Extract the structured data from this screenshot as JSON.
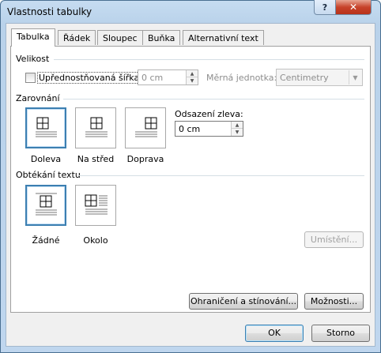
{
  "window": {
    "title": "Vlastnosti tabulky",
    "help_glyph": "?",
    "close_glyph": "✕"
  },
  "tabs": [
    "Tabulka",
    "Řádek",
    "Sloupec",
    "Buňka",
    "Alternativní text"
  ],
  "size": {
    "group_label": "Velikost",
    "preferred_width_label": "Upřednostňovaná šířka:",
    "preferred_width_checked": false,
    "width_value": "0 cm",
    "unit_label": "Měrná jednotka:",
    "unit_value": "Centimetry"
  },
  "alignment": {
    "group_label": "Zarovnání",
    "options": [
      "Doleva",
      "Na střed",
      "Doprava"
    ],
    "selected": "Doleva",
    "indent_label": "Odsazení zleva:",
    "indent_value": "0 cm"
  },
  "wrapping": {
    "group_label": "Obtékání textu",
    "options": [
      "Žádné",
      "Okolo"
    ],
    "selected": "Žádné",
    "positioning_button": "Umístění..."
  },
  "buttons": {
    "borders": "Ohraničení a stínování...",
    "options": "Možnosti...",
    "ok": "OK",
    "cancel": "Storno"
  },
  "colors": {
    "selection_border": "#3c7fb1",
    "title_bar": "#bfd6ee",
    "dialog_bg": "#f0f0f0"
  },
  "icons": [
    "table-align-left-icon",
    "table-align-center-icon",
    "table-align-right-icon",
    "wrap-none-icon",
    "wrap-around-icon"
  ]
}
